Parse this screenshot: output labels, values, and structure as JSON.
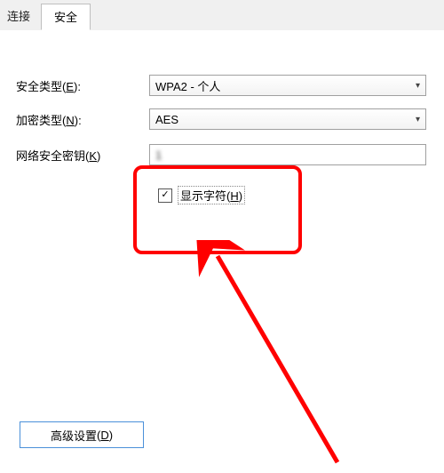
{
  "tabs": {
    "connect": "连接",
    "security": "安全"
  },
  "fields": {
    "security_type": {
      "label": "安全类型",
      "hotkey": "E",
      "value": "WPA2 - 个人"
    },
    "encryption": {
      "label": "加密类型",
      "hotkey": "N",
      "value": "AES"
    },
    "network_key": {
      "label": "网络安全密钥",
      "hotkey": "K",
      "value": "1"
    }
  },
  "show_chars": {
    "label": "显示字符",
    "hotkey": "H",
    "checked": true
  },
  "advanced_button": {
    "label": "高级设置",
    "hotkey": "D"
  }
}
